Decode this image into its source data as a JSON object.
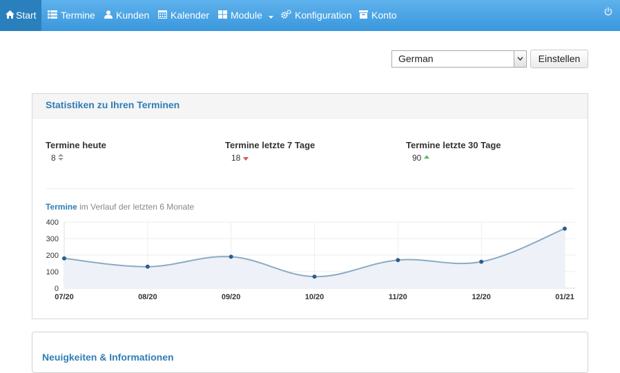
{
  "nav": {
    "items": [
      {
        "label": "Start",
        "icon": "home-icon"
      },
      {
        "label": "Termine",
        "icon": "list-icon"
      },
      {
        "label": "Kunden",
        "icon": "user-icon"
      },
      {
        "label": "Kalender",
        "icon": "calendar-icon"
      },
      {
        "label": "Module",
        "icon": "grid-icon"
      },
      {
        "label": "Konfiguration",
        "icon": "gears-icon"
      },
      {
        "label": "Konto",
        "icon": "box-icon"
      }
    ],
    "active": "Start"
  },
  "language": {
    "selected": "German",
    "button": "Einstellen"
  },
  "stats_panel": {
    "title": "Statistiken zu Ihren Terminen",
    "stats": [
      {
        "label": "Termine heute",
        "value": "8",
        "trend": "neutral"
      },
      {
        "label": "Termine letzte 7 Tage",
        "value": "18",
        "trend": "down"
      },
      {
        "label": "Termine letzte 30 Tage",
        "value": "90",
        "trend": "up"
      }
    ],
    "chart_title_strong": "Termine",
    "chart_title_rest": "im Verlauf der letzten 6 Monate"
  },
  "news_panel": {
    "title": "Neuigkeiten & Informationen"
  },
  "colors": {
    "nav_bg": "#3a97dc",
    "accent": "#2f7db5",
    "line": "#8aaac4",
    "point": "#2a5f8f",
    "area": "#eef1f7",
    "trend_down": "#d9534f",
    "trend_up": "#5cb85c"
  },
  "chart_data": {
    "type": "area",
    "categories": [
      "07/20",
      "08/20",
      "09/20",
      "10/20",
      "11/20",
      "12/20",
      "01/21"
    ],
    "series": [
      {
        "values": [
          180,
          130,
          190,
          70,
          170,
          160,
          360
        ]
      }
    ],
    "ylim": [
      0,
      400
    ],
    "yticks": [
      0,
      100,
      200,
      300,
      400
    ],
    "grid": true
  }
}
